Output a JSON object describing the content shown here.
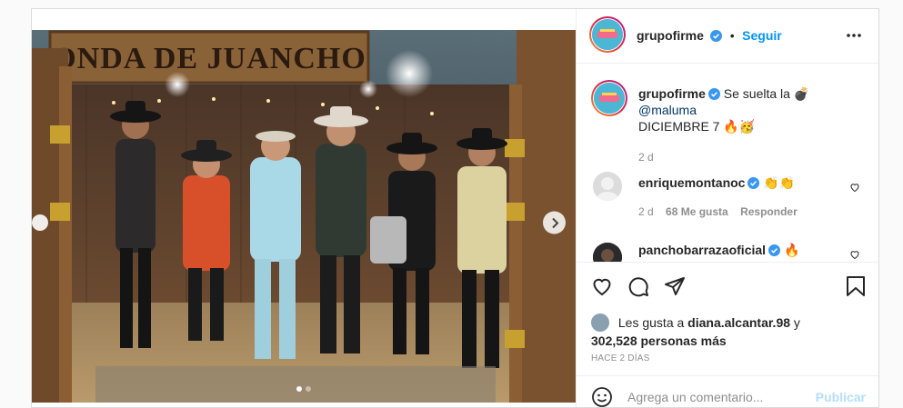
{
  "post": {
    "media": {
      "sign_text": "ONDA DE JUANCHO",
      "slide_count": 2,
      "active_slide": 1
    },
    "header": {
      "username": "grupofirme",
      "separator": "•",
      "follow_label": "Seguir"
    },
    "caption": {
      "username": "grupofirme",
      "text_before": "Se suelta la",
      "text_emoji": "💣",
      "mention": "@maluma",
      "text_after": "DICIEMBRE 7",
      "emojis_after": "🔥🥳",
      "age": "2 d"
    },
    "comments": [
      {
        "username": "enriquemontanoc",
        "emojis": "👏👏",
        "age": "2 d",
        "likes": "68 Me gusta",
        "reply_label": "Responder"
      },
      {
        "username": "panchobarrazaoficial",
        "emojis": "🔥"
      }
    ],
    "likes": {
      "prefix": "Les gusta a",
      "user": "diana.alcantar.98",
      "joiner": "y",
      "others": "302,528 personas más"
    },
    "timestamp": "HACE 2 DÍAS",
    "add_comment": {
      "placeholder": "Agrega un comentario...",
      "publish_label": "Publicar"
    },
    "icons": {
      "more": "more-horizontal-icon",
      "like": "heart-icon",
      "comment": "comment-bubble-icon",
      "share": "paper-plane-icon",
      "save": "bookmark-icon",
      "emoji": "smiley-icon",
      "verified": "verified-badge-icon",
      "next": "chevron-right-icon"
    },
    "colors": {
      "link_blue": "#0095f6",
      "publish_disabled": "#b2dffc",
      "text": "#262626",
      "muted": "#8e8e8e",
      "border": "#dbdbdb"
    }
  }
}
